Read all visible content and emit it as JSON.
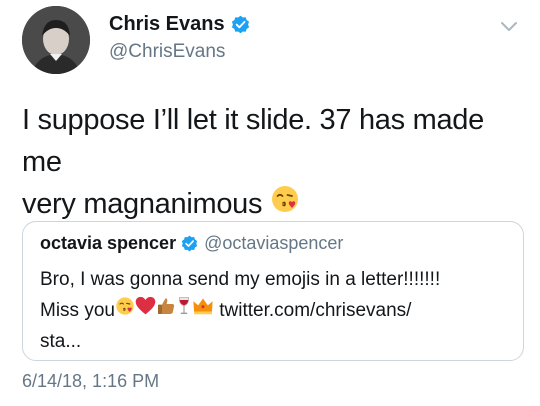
{
  "tweet": {
    "display_name": "Chris Evans",
    "handle": "@ChrisEvans",
    "text_line1": "I suppose I’ll let it slide. 37 has made me",
    "text_line2": "very magnanimous",
    "timestamp": "6/14/18, 1:16 PM"
  },
  "quoted_tweet": {
    "display_name": "octavia spencer",
    "handle": "@octaviaspencer",
    "line1": "Bro, I was gonna send my emojis in a letter!!!!!!!",
    "line2_prefix": "Miss you",
    "link": "twitter.com/chrisevans/",
    "line3": "sta..."
  },
  "icons": {
    "verified": "verified-badge-icon",
    "caret": "chevron-down-icon",
    "emojis": [
      "face-blowing-kiss",
      "red-heart",
      "thumbs-up-medium-skin",
      "wine-glass",
      "crown"
    ]
  },
  "colors": {
    "verified_blue": "#1da1f2",
    "secondary_text": "#657786",
    "border": "#ccd6dd"
  }
}
